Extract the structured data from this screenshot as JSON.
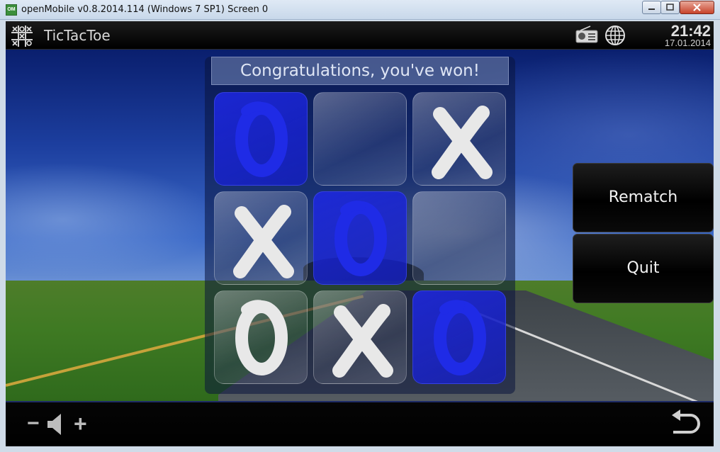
{
  "window": {
    "title": "openMobile v0.8.2014.114 (Windows 7 SP1) Screen 0",
    "icon_label": "OM",
    "minimize_icon": "minimize-icon",
    "maximize_icon": "maximize-icon",
    "close_icon": "close-icon"
  },
  "topbar": {
    "app_title": "TicTacToe",
    "app_icon": "tictactoe-grid-icon",
    "radio_icon": "radio-icon",
    "globe_icon": "globe-icon",
    "time": "21:42",
    "date": "17.01.2014"
  },
  "game": {
    "status": "Congratulations, you've won!",
    "board": [
      {
        "mark": "O",
        "color": "#1f2be6",
        "highlight": true
      },
      {
        "mark": "",
        "color": "",
        "highlight": false
      },
      {
        "mark": "X",
        "color": "#e8e8e8",
        "highlight": false
      },
      {
        "mark": "X",
        "color": "#e8e8e8",
        "highlight": false
      },
      {
        "mark": "O",
        "color": "#1f2be6",
        "highlight": true
      },
      {
        "mark": "",
        "color": "",
        "highlight": false
      },
      {
        "mark": "O",
        "color": "#e8e8e8",
        "highlight": false
      },
      {
        "mark": "X",
        "color": "#e8e8e8",
        "highlight": false
      },
      {
        "mark": "O",
        "color": "#1f2be6",
        "highlight": true
      }
    ]
  },
  "buttons": {
    "rematch": "Rematch",
    "quit": "Quit"
  },
  "bottombar": {
    "volume_down": "−",
    "volume_up": "+",
    "speaker_icon": "speaker-icon",
    "back_icon": "back-arrow-icon"
  },
  "colors": {
    "win_highlight": "#1f2be6",
    "x_mark": "#e8e8e8",
    "bar_background": "#000000"
  }
}
